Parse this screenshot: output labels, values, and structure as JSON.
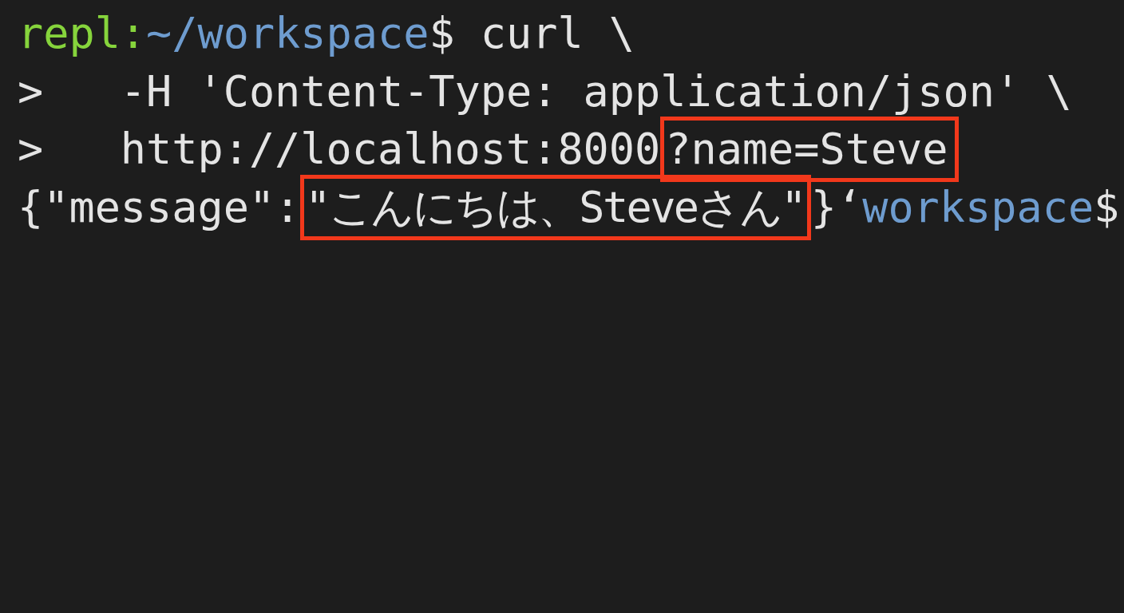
{
  "terminal": {
    "lines": [
      {
        "segments": [
          {
            "text": "repl:",
            "kind": "host",
            "highlighted": false
          },
          {
            "text": "~/workspace",
            "kind": "path",
            "highlighted": false
          },
          {
            "text": "$",
            "kind": "symbol",
            "highlighted": false
          },
          {
            "text": "curl \\",
            "kind": "command",
            "highlighted": false
          }
        ]
      },
      {
        "segments": [
          {
            "text": ">",
            "kind": "continuation",
            "highlighted": false
          },
          {
            "text": "-H 'Content-Type: application/json' \\",
            "kind": "command",
            "highlighted": false
          }
        ]
      },
      {
        "segments": [
          {
            "text": ">",
            "kind": "continuation",
            "highlighted": false
          },
          {
            "text": "http://localhost:8000",
            "kind": "command",
            "highlighted": false
          },
          {
            "text": "?name=Steve",
            "kind": "command",
            "highlighted": true
          }
        ]
      },
      {
        "segments": [
          {
            "text": "{\"message\":",
            "kind": "output",
            "highlighted": false
          },
          {
            "text": "\"こんにちは、Steveさん\"",
            "kind": "output",
            "highlighted": true
          },
          {
            "text": "}‘",
            "kind": "output",
            "highlighted": false
          },
          {
            "text": "workspace",
            "kind": "path",
            "highlighted": false
          },
          {
            "text": "$",
            "kind": "symbol",
            "highlighted": false
          }
        ]
      }
    ]
  }
}
